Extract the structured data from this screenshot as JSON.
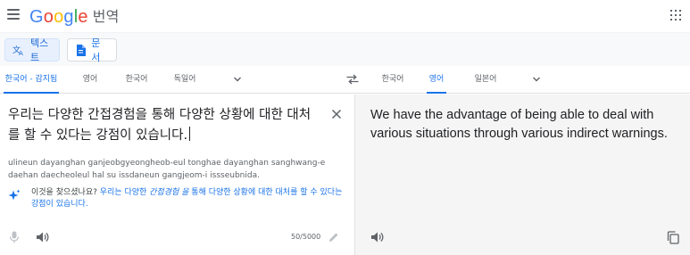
{
  "header": {
    "logo_letters": [
      "G",
      "o",
      "o",
      "g",
      "l",
      "e"
    ],
    "product": "번역",
    "menu_icon": "hamburger-icon",
    "apps_icon": "apps-grid-icon"
  },
  "modes": [
    {
      "label": "텍스트",
      "icon": "translate-icon",
      "active": true
    },
    {
      "label": "문서",
      "icon": "document-icon",
      "active": false
    }
  ],
  "source_languages": [
    "한국어 - 감지됨",
    "영어",
    "한국어",
    "독일어"
  ],
  "source_selected": 0,
  "target_languages": [
    "한국어",
    "영어",
    "일본어"
  ],
  "target_selected": 1,
  "source": {
    "text": "우리는 다양한 간접경험을 통해 다양한 상황에 대한 대처를 할 수 있다는 강점이 있습니다.",
    "romanization": "ulineun dayanghan ganjeobgyeongheob-eul tonghae dayanghan sanghwang-e daehan daecheoleul hal su issdaneun gangjeom-i issseubnida.",
    "suggestion_prefix": "이것을 찾으셨나요? ",
    "suggestion_part1": "우리는 다양한 ",
    "suggestion_emph": "간접경험 을",
    "suggestion_part2": " 통해 다양한 상황에 대한 대처를 할 수 있다는 강점이 있습니다.",
    "char_count": "50/5000"
  },
  "target": {
    "text": "We have the advantage of being able to deal with various situations through various indirect warnings."
  },
  "colors": {
    "accent": "#1a73e8",
    "panel_gray": "#f5f5f5",
    "text_secondary": "#5f6368"
  }
}
